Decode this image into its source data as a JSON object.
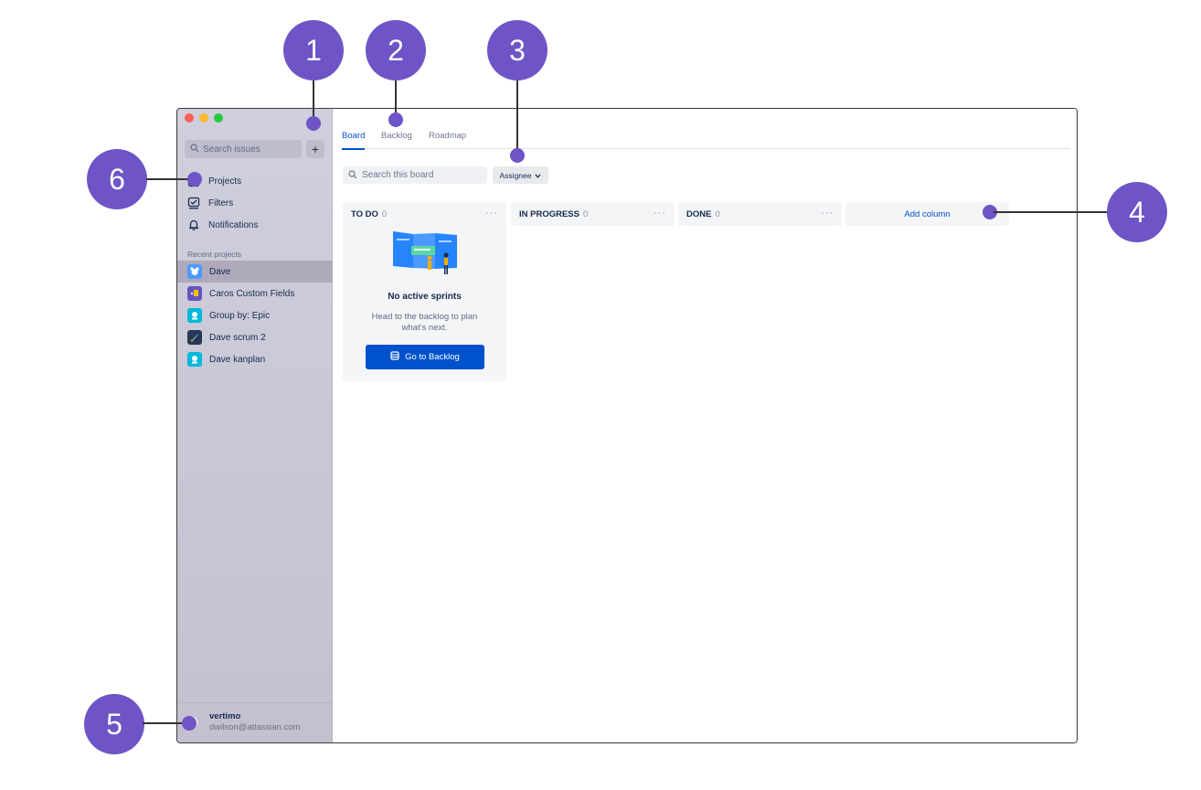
{
  "sidebar": {
    "search_placeholder": "Search issues",
    "add_label": "+",
    "nav": [
      {
        "label": "Projects",
        "icon": "projects-icon"
      },
      {
        "label": "Filters",
        "icon": "filter-icon"
      },
      {
        "label": "Notifications",
        "icon": "bell-icon"
      }
    ],
    "recent_title": "Recent projects",
    "projects": [
      {
        "label": "Dave",
        "icon": "dave-project-icon",
        "color": "#4c9aff",
        "selected": true
      },
      {
        "label": "Caros Custom Fields",
        "icon": "caros-project-icon",
        "color": "#6554c0"
      },
      {
        "label": "Group by: Epic",
        "icon": "group-epic-project-icon",
        "color": "#00b8d9"
      },
      {
        "label": "Dave scrum 2",
        "icon": "rocket-project-icon",
        "color": "#253858"
      },
      {
        "label": "Dave kanplan",
        "icon": "kanplan-project-icon",
        "color": "#00b8d9"
      }
    ],
    "user": {
      "name": "vertimo",
      "email": "dwilson@atlassian.com"
    }
  },
  "tabs": [
    {
      "label": "Board",
      "active": true
    },
    {
      "label": "Backlog",
      "active": false
    },
    {
      "label": "Roadmap",
      "active": false
    }
  ],
  "board": {
    "search_placeholder": "Search this board",
    "assignee_label": "Assignee",
    "columns": [
      {
        "title": "TO DO",
        "count": "0"
      },
      {
        "title": "IN PROGRESS",
        "count": "0"
      },
      {
        "title": "DONE",
        "count": "0"
      }
    ],
    "add_column_label": "Add column",
    "empty_state": {
      "title": "No active sprints",
      "description": "Head to the backlog to plan what's next.",
      "button_label": "Go to Backlog"
    }
  },
  "callouts": [
    "1",
    "2",
    "3",
    "4",
    "5",
    "6"
  ],
  "colors": {
    "accent": "#0052cc",
    "callout": "#6e54c6"
  }
}
